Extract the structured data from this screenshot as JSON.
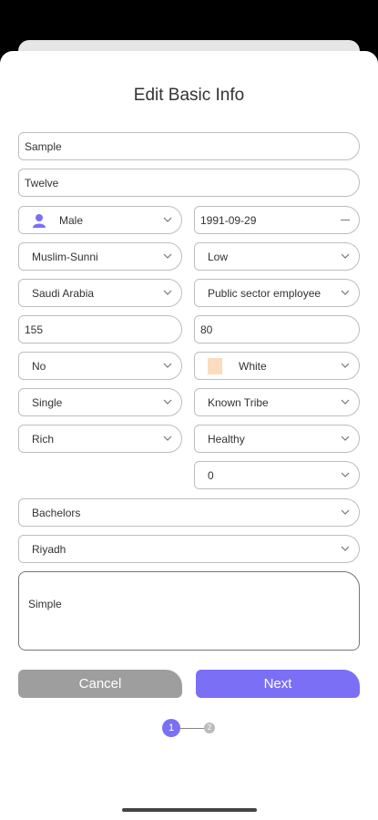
{
  "header": {
    "title": "Edit Basic Info"
  },
  "form": {
    "first_name": "Sample",
    "last_name": "Twelve",
    "gender": "Male",
    "birth_date": "1991-09-29",
    "religion": "Muslim-Sunni",
    "level": "Low",
    "country": "Saudi Arabia",
    "occupation": "Public sector employee",
    "height": "155",
    "weight": "80",
    "option_no": "No",
    "skin_color": "White",
    "marital_status": "Single",
    "tribe": "Known Tribe",
    "financial_status": "Rich",
    "health": "Healthy",
    "children": "0",
    "education": "Bachelors",
    "city": "Riyadh",
    "bio": "Simple"
  },
  "buttons": {
    "cancel": "Cancel",
    "next": "Next"
  },
  "stepper": {
    "step1": "1",
    "step2": "2"
  },
  "colors": {
    "accent": "#7b6ff5",
    "cancel": "#9e9e9e",
    "skin_swatch": "#fbdcbf"
  }
}
